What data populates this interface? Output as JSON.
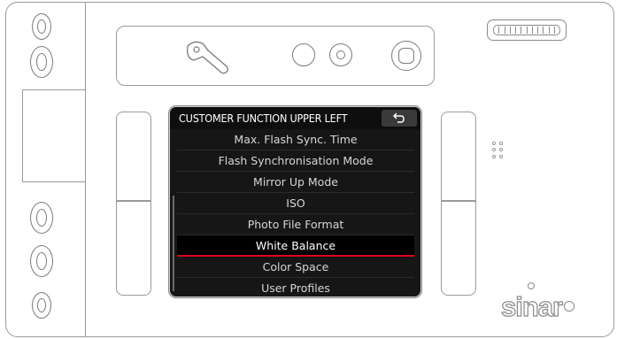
{
  "screen": {
    "title": "CUSTOMER FUNCTION UPPER LEFT",
    "back_icon": "back-arrow-icon",
    "menu_items": [
      "Max. Flash Sync. Time",
      "Flash Synchronisation Mode",
      "Mirror Up Mode",
      "ISO",
      "Photo File Format",
      "White Balance",
      "Color Space",
      "User Profiles"
    ],
    "selected_item": "White Balance"
  },
  "device": {
    "brand": "sinar",
    "brand_mark": "®"
  },
  "colors": {
    "lcd_background": "#161616",
    "selection_underline": "#e2001a",
    "outline": "#8a8a8a"
  }
}
